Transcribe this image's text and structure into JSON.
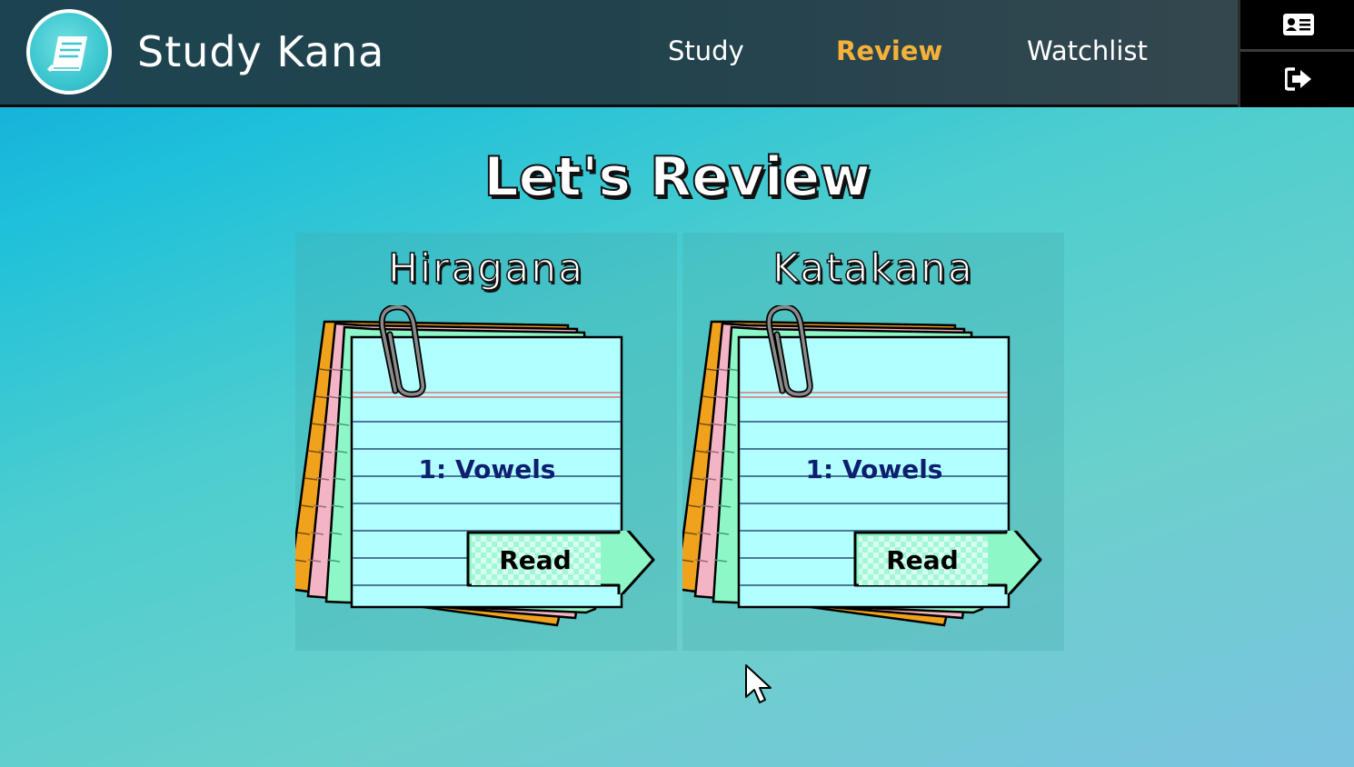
{
  "header": {
    "app_title": "Study Kana",
    "logo_icon": "book-icon",
    "nav": [
      {
        "label": "Study",
        "active": false
      },
      {
        "label": "Review",
        "active": true
      },
      {
        "label": "Watchlist",
        "active": false
      }
    ],
    "side_buttons": [
      "profile-card-icon",
      "logout-icon"
    ]
  },
  "main": {
    "title": "Let's Review",
    "decks": [
      {
        "title": "Hiragana",
        "card_label": "1: Vowels",
        "button_label": "Read"
      },
      {
        "title": "Katakana",
        "card_label": "1: Vowels",
        "button_label": "Read"
      }
    ]
  },
  "colors": {
    "accent": "#f5b13a",
    "header_bg": "#23434d",
    "card_blue": "#b1ffff",
    "card_green": "#8ef7c8",
    "card_pink": "#f3b4c6",
    "card_orange": "#f0a21c",
    "card_text": "#0f1f6f"
  }
}
